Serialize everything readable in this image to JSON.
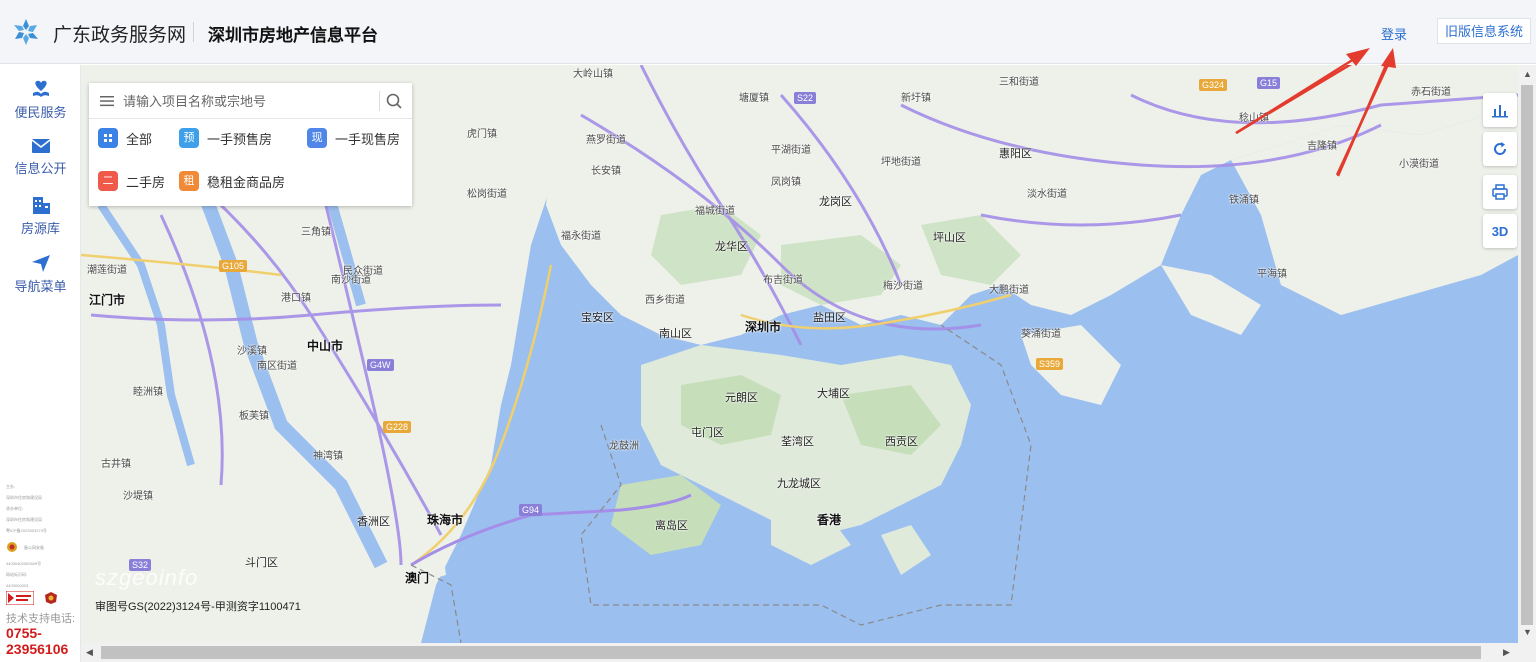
{
  "header": {
    "brand": "广东政务服务网",
    "subtitle": "深圳市房地产信息平台",
    "login": "登录",
    "old_system": "旧版信息系统"
  },
  "sidebar": {
    "items": [
      {
        "label": "便民服务",
        "icon": "heart-hand-icon"
      },
      {
        "label": "信息公开",
        "icon": "mail-icon"
      },
      {
        "label": "房源库",
        "icon": "building-icon"
      },
      {
        "label": "导航菜单",
        "icon": "navigation-icon"
      }
    ],
    "footer_lines": [
      "主办:",
      "深圳市住房和建设局",
      "承办单位:",
      "深圳市住房和建设局",
      "粤ICP备2023003273号",
      "备公网安备",
      "44030402002609号",
      "网站标识码:",
      "4403000003"
    ],
    "tech_support": "技术支持电话:",
    "phone": "0755-23956106"
  },
  "search": {
    "placeholder": "请输入项目名称或宗地号",
    "filters": [
      {
        "tag": "",
        "label": "全部",
        "color": "#3b82e6"
      },
      {
        "tag": "预",
        "label": "一手预售房",
        "color": "#3f9fe8"
      },
      {
        "tag": "现",
        "label": "一手现售房",
        "color": "#4f86e8"
      },
      {
        "tag": "二",
        "label": "二手房",
        "color": "#ef5a4b"
      },
      {
        "tag": "租",
        "label": "稳租金商品房",
        "color": "#f08a37"
      }
    ]
  },
  "tools": [
    {
      "icon": "bar-chart-icon",
      "label": ""
    },
    {
      "icon": "refresh-icon",
      "label": ""
    },
    {
      "icon": "print-icon",
      "label": ""
    },
    {
      "icon": "3d-icon",
      "label": "3D"
    }
  ],
  "map": {
    "watermark": "szgeoinfo",
    "copyright": "审图号GS(2022)3124号-甲测资字1100471",
    "places": [
      {
        "name": "大岭山镇",
        "cls": ""
      },
      {
        "name": "虎门镇",
        "cls": ""
      },
      {
        "name": "燕罗街道",
        "cls": ""
      },
      {
        "name": "塘厦镇",
        "cls": ""
      },
      {
        "name": "新圩镇",
        "cls": ""
      },
      {
        "name": "三和街道",
        "cls": ""
      },
      {
        "name": "惠阳区",
        "cls": "big"
      },
      {
        "name": "稔山镇",
        "cls": ""
      },
      {
        "name": "吉隆镇",
        "cls": ""
      },
      {
        "name": "赤石街道",
        "cls": ""
      },
      {
        "name": "小漠街道",
        "cls": ""
      },
      {
        "name": "铁涌镇",
        "cls": ""
      },
      {
        "name": "平海镇",
        "cls": ""
      },
      {
        "name": "龙岗区",
        "cls": "big"
      },
      {
        "name": "坪山区",
        "cls": "big"
      },
      {
        "name": "龙华区",
        "cls": "big"
      },
      {
        "name": "福城街道",
        "cls": ""
      },
      {
        "name": "福永街道",
        "cls": ""
      },
      {
        "name": "宝安区",
        "cls": "big"
      },
      {
        "name": "南山区",
        "cls": "big"
      },
      {
        "name": "深圳市",
        "cls": "city"
      },
      {
        "name": "盐田区",
        "cls": "big"
      },
      {
        "name": "大鹏街道",
        "cls": ""
      },
      {
        "name": "葵涌街道",
        "cls": ""
      },
      {
        "name": "元朗区",
        "cls": "big"
      },
      {
        "name": "大埔区",
        "cls": "big"
      },
      {
        "name": "屯门区",
        "cls": "big"
      },
      {
        "name": "荃湾区",
        "cls": "big"
      },
      {
        "name": "西贡区",
        "cls": "big"
      },
      {
        "name": "九龙城区",
        "cls": "big"
      },
      {
        "name": "香港",
        "cls": "city"
      },
      {
        "name": "离岛区",
        "cls": "big"
      },
      {
        "name": "龙鼓洲",
        "cls": ""
      },
      {
        "name": "中山市",
        "cls": "city"
      },
      {
        "name": "珠海市",
        "cls": "city"
      },
      {
        "name": "澳门",
        "cls": "city"
      },
      {
        "name": "江门市",
        "cls": "city"
      },
      {
        "name": "南沙街道",
        "cls": ""
      },
      {
        "name": "三角镇",
        "cls": ""
      },
      {
        "name": "民众街道",
        "cls": ""
      },
      {
        "name": "港口镇",
        "cls": ""
      },
      {
        "name": "沙溪镇",
        "cls": ""
      },
      {
        "name": "南区街道",
        "cls": ""
      },
      {
        "name": "板芙镇",
        "cls": ""
      },
      {
        "name": "神湾镇",
        "cls": ""
      },
      {
        "name": "香洲区",
        "cls": "big"
      },
      {
        "name": "斗门区",
        "cls": "big"
      },
      {
        "name": "沙堤镇",
        "cls": ""
      },
      {
        "name": "古井镇",
        "cls": ""
      },
      {
        "name": "睦洲镇",
        "cls": ""
      },
      {
        "name": "潮莲街道",
        "cls": ""
      },
      {
        "name": "西乡街道",
        "cls": ""
      },
      {
        "name": "布吉街道",
        "cls": ""
      },
      {
        "name": "梅沙街道",
        "cls": ""
      },
      {
        "name": "凤岗镇",
        "cls": ""
      },
      {
        "name": "坪地街道",
        "cls": ""
      },
      {
        "name": "淡水街道",
        "cls": ""
      },
      {
        "name": "平湖街道",
        "cls": ""
      },
      {
        "name": "长安镇",
        "cls": ""
      },
      {
        "name": "松岗街道",
        "cls": ""
      }
    ],
    "roads": [
      "S22",
      "G15",
      "G324",
      "G4W",
      "G228",
      "G94",
      "S359",
      "G105",
      "S32"
    ]
  }
}
